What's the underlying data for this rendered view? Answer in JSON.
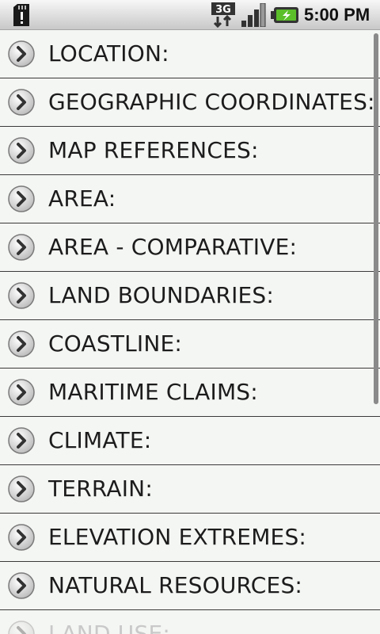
{
  "status_bar": {
    "time": "5:00 PM",
    "network_label": "3G",
    "icons": [
      "sd-card-warning-icon",
      "3g-data-icon",
      "signal-strength-icon",
      "battery-charging-icon"
    ]
  },
  "list": {
    "items": [
      {
        "label": "LOCATION:"
      },
      {
        "label": "GEOGRAPHIC COORDINATES:"
      },
      {
        "label": "MAP REFERENCES:"
      },
      {
        "label": "AREA:"
      },
      {
        "label": "AREA - COMPARATIVE:"
      },
      {
        "label": "LAND BOUNDARIES:"
      },
      {
        "label": "COASTLINE:"
      },
      {
        "label": "MARITIME CLAIMS:"
      },
      {
        "label": "CLIMATE:"
      },
      {
        "label": "TERRAIN:"
      },
      {
        "label": "ELEVATION EXTREMES:"
      },
      {
        "label": "NATURAL RESOURCES:"
      },
      {
        "label": "LAND USE:"
      }
    ]
  },
  "colors": {
    "background": "#f4f6f3",
    "divider": "#3a3a3a",
    "text": "#1c1c1c"
  }
}
